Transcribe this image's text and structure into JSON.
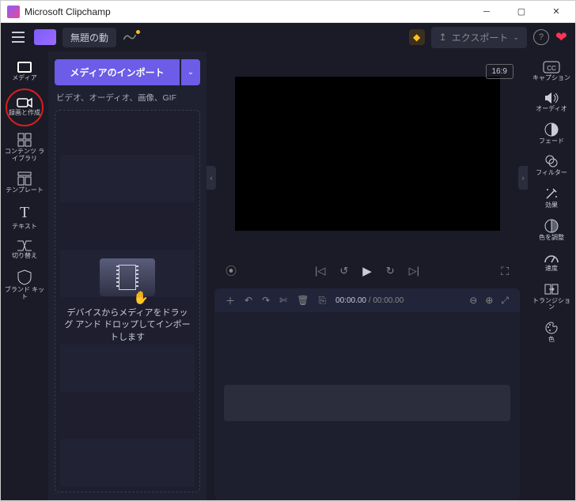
{
  "window": {
    "title": "Microsoft Clipchamp"
  },
  "topbar": {
    "project_name": "無題の動",
    "export_label": "エクスポート"
  },
  "left_rail": {
    "items": [
      {
        "label": "メディア"
      },
      {
        "label": "録画と作成"
      },
      {
        "label": "コンテンツ ライブラリ"
      },
      {
        "label": "テンプレート"
      },
      {
        "label": "テキスト"
      },
      {
        "label": "切り替え"
      },
      {
        "label": "ブランド キット"
      }
    ]
  },
  "media_panel": {
    "import_button": "メディアのインポート",
    "types_hint": "ビデオ、オーディオ、画像、GIF",
    "drop_text": "デバイスからメディアをドラッグ アンド ドロップしてインポートします"
  },
  "preview": {
    "aspect": "16:9"
  },
  "timeline": {
    "current_time": "00:00.00",
    "total_time": "00:00.00"
  },
  "right_rail": {
    "items": [
      {
        "label": "キャプション"
      },
      {
        "label": "オーディオ"
      },
      {
        "label": "フェード"
      },
      {
        "label": "フィルター"
      },
      {
        "label": "効果"
      },
      {
        "label": "色を調整"
      },
      {
        "label": "速度"
      },
      {
        "label": "トランジション"
      },
      {
        "label": "色"
      }
    ]
  }
}
